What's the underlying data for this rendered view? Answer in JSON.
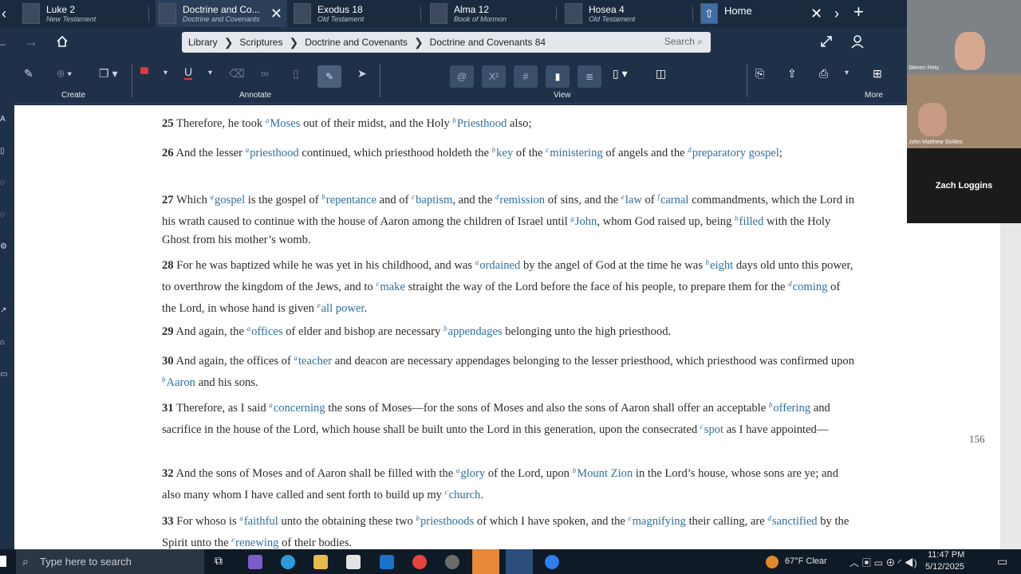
{
  "tabs": [
    {
      "title": "Luke 2",
      "subtitle": "New Testament"
    },
    {
      "title": "Doctrine and Co...",
      "subtitle": "Doctrine and Covenants"
    },
    {
      "title": "Exodus 18",
      "subtitle": "Old Testament"
    },
    {
      "title": "Alma 12",
      "subtitle": "Book of Mormon"
    },
    {
      "title": "Hosea 4",
      "subtitle": "Old Testament"
    },
    {
      "title": "Home",
      "subtitle": ""
    }
  ],
  "breadcrumb": [
    "Library",
    "Scriptures",
    "Doctrine and Covenants",
    "Doctrine and Covenants 84"
  ],
  "search_placeholder": "Search",
  "toolbar": {
    "create": "Create",
    "annotate": "Annotate",
    "view": "View",
    "more": "More"
  },
  "page_number": "156",
  "verses": [
    {
      "num": "25",
      "text": "Therefore, he took <span class='fn'><sup>a</sup>Moses</span> out of their midst, and the Holy <span class='fn'><sup>b</sup>Priesthood</span> also;"
    },
    {
      "num": "26",
      "text": "And the lesser <span class='fn'><sup>a</sup>priesthood</span> continued, which priesthood holdeth the <span class='fn'><sup>b</sup>key</span> of the <span class='fn'><sup>c</sup>ministering</span> of angels and the <span class='fn'><sup>d</sup>preparatory gospel</span>;"
    },
    {
      "num": "27",
      "text": "Which <span class='fn'><sup>a</sup>gospel</span> is the gospel of <span class='fn'><sup>b</sup>repentance</span> and of <span class='fn'><sup>c</sup>baptism</span>, and the <span class='fn'><sup>d</sup>remission</span> of sins, and the <span class='fn'><sup>e</sup>law</span> of <span class='fn'><sup>f</sup>carnal</span> commandments, which the Lord in his wrath caused to continue with the house of Aaron among the children of Israel until <span class='fn'><sup>g</sup>John</span>, whom God raised up, being <span class='fn'><sup>h</sup>filled</span> with the Holy Ghost from his mother’s womb."
    },
    {
      "num": "28",
      "text": "For he was baptized while he was yet in his childhood, and was <span class='fn'><sup>a</sup>ordained</span> by the angel of God at the time he was <span class='fn'><sup>b</sup>eight</span> days old unto this power, to overthrow the kingdom of the Jews, and to <span class='fn'><sup>c</sup>make</span> straight the way of the Lord before the face of his people, to prepare them for the <span class='fn'><sup>d</sup>coming</span> of the Lord, in whose hand is given <span class='fn'><sup>e</sup>all power</span>."
    },
    {
      "num": "29",
      "text": "And again, the <span class='fn'><sup>a</sup>offices</span> of elder and bishop are necessary <span class='fn'><sup>b</sup>appendages</span> belonging unto the high priesthood."
    },
    {
      "num": "30",
      "text": "And again, the offices of <span class='fn'><sup>a</sup>teacher</span> and deacon are necessary appendages belonging to the lesser priesthood, which priesthood was confirmed upon <span class='fn'><sup>b</sup>Aaron</span> and his sons."
    },
    {
      "num": "31",
      "text": "Therefore, as I said <span class='fn'><sup>a</sup>concerning</span> the sons of Moses—for the sons of Moses and also the sons of Aaron shall offer an acceptable <span class='fn'><sup>b</sup>offering</span> and sacrifice in the house of the Lord, which house shall be built unto the Lord in this generation, upon the consecrated <span class='fn'><sup>c</sup>spot</span> as I have appointed—"
    },
    {
      "num": "32",
      "text": "And the sons of Moses and of Aaron shall be filled with the <span class='fn'><sup>a</sup>glory</span> of the Lord, upon <span class='fn'><sup>b</sup>Mount Zion</span> in the Lord’s house, whose sons are ye; and also many whom I have called and sent forth to build up my <span class='fn'><sup>c</sup>church</span>."
    },
    {
      "num": "33",
      "text": "For whoso is <span class='fn'><sup>a</sup>faithful</span> unto the obtaining these two <span class='fn'><sup>b</sup>priesthoods</span> of which I have spoken, and the <span class='fn'><sup>c</sup>magnifying</span> their calling, are <span class='fn'><sup>d</sup>sanctified</span> by the Spirit unto the <span class='fn'><sup>e</sup>renewing</span> of their bodies."
    }
  ],
  "participants": [
    "Steven Retz",
    "John Matthew Sickles",
    "Zach Loggins"
  ],
  "taskbar": {
    "search_placeholder": "Type here to search",
    "weather": "67°F  Clear",
    "time": "11:47 PM",
    "date": "5/12/2025"
  }
}
